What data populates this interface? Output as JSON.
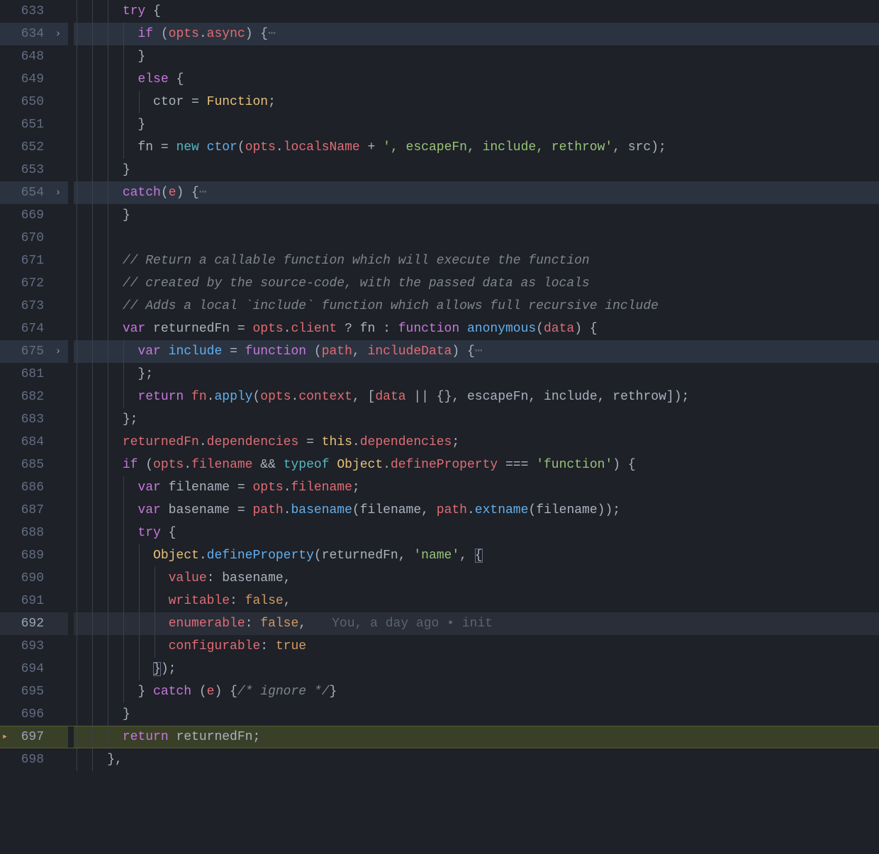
{
  "lines": [
    {
      "n": 633,
      "fold": "",
      "cls": "",
      "seg": [
        {
          "t": "      ",
          "c": "t",
          "guides": 3
        },
        {
          "t": "try",
          "c": "k"
        },
        {
          "t": " {",
          "c": "p"
        }
      ]
    },
    {
      "n": 634,
      "fold": ">",
      "cls": "folded",
      "seg": [
        {
          "t": "        ",
          "c": "t",
          "guides": 4
        },
        {
          "t": "if",
          "c": "k"
        },
        {
          "t": " (",
          "c": "p"
        },
        {
          "t": "opts",
          "c": "v"
        },
        {
          "t": ".",
          "c": "p"
        },
        {
          "t": "async",
          "c": "prop"
        },
        {
          "t": ") {",
          "c": "p"
        },
        {
          "t": "⋯",
          "c": "dim",
          "ell": true
        }
      ]
    },
    {
      "n": 648,
      "fold": "",
      "cls": "",
      "seg": [
        {
          "t": "        ",
          "c": "t",
          "guides": 4
        },
        {
          "t": "}",
          "c": "p"
        }
      ]
    },
    {
      "n": 649,
      "fold": "",
      "cls": "",
      "seg": [
        {
          "t": "        ",
          "c": "t",
          "guides": 4
        },
        {
          "t": "else",
          "c": "k"
        },
        {
          "t": " {",
          "c": "p"
        }
      ]
    },
    {
      "n": 650,
      "fold": "",
      "cls": "",
      "seg": [
        {
          "t": "          ",
          "c": "t",
          "guides": 5
        },
        {
          "t": "ctor",
          "c": "t"
        },
        {
          "t": " = ",
          "c": "p"
        },
        {
          "t": "Function",
          "c": "cl"
        },
        {
          "t": ";",
          "c": "p"
        }
      ]
    },
    {
      "n": 651,
      "fold": "",
      "cls": "",
      "seg": [
        {
          "t": "        ",
          "c": "t",
          "guides": 4
        },
        {
          "t": "}",
          "c": "p"
        }
      ]
    },
    {
      "n": 652,
      "fold": "",
      "cls": "",
      "seg": [
        {
          "t": "        ",
          "c": "t",
          "guides": 4
        },
        {
          "t": "fn",
          "c": "t"
        },
        {
          "t": " = ",
          "c": "p"
        },
        {
          "t": "new",
          "c": "o"
        },
        {
          "t": " ",
          "c": "p"
        },
        {
          "t": "ctor",
          "c": "f"
        },
        {
          "t": "(",
          "c": "p"
        },
        {
          "t": "opts",
          "c": "v"
        },
        {
          "t": ".",
          "c": "p"
        },
        {
          "t": "localsName",
          "c": "prop"
        },
        {
          "t": " + ",
          "c": "p"
        },
        {
          "t": "', escapeFn, include, rethrow'",
          "c": "s"
        },
        {
          "t": ", ",
          "c": "p"
        },
        {
          "t": "src",
          "c": "t"
        },
        {
          "t": ");",
          "c": "p"
        }
      ]
    },
    {
      "n": 653,
      "fold": "",
      "cls": "",
      "seg": [
        {
          "t": "      ",
          "c": "t",
          "guides": 3
        },
        {
          "t": "}",
          "c": "p"
        }
      ]
    },
    {
      "n": 654,
      "fold": ">",
      "cls": "folded",
      "seg": [
        {
          "t": "      ",
          "c": "t",
          "guides": 3
        },
        {
          "t": "catch",
          "c": "k"
        },
        {
          "t": "(",
          "c": "p"
        },
        {
          "t": "e",
          "c": "v"
        },
        {
          "t": ") {",
          "c": "p"
        },
        {
          "t": "⋯",
          "c": "dim",
          "ell": true
        }
      ]
    },
    {
      "n": 669,
      "fold": "",
      "cls": "",
      "seg": [
        {
          "t": "      ",
          "c": "t",
          "guides": 3
        },
        {
          "t": "}",
          "c": "p"
        }
      ]
    },
    {
      "n": 670,
      "fold": "",
      "cls": "",
      "seg": [
        {
          "t": "",
          "c": "t",
          "guides": 3
        }
      ]
    },
    {
      "n": 671,
      "fold": "",
      "cls": "",
      "seg": [
        {
          "t": "      ",
          "c": "t",
          "guides": 3
        },
        {
          "t": "// Return a callable function which will execute the function",
          "c": "c"
        }
      ]
    },
    {
      "n": 672,
      "fold": "",
      "cls": "",
      "seg": [
        {
          "t": "      ",
          "c": "t",
          "guides": 3
        },
        {
          "t": "// created by the source-code, with the passed data as locals",
          "c": "c"
        }
      ]
    },
    {
      "n": 673,
      "fold": "",
      "cls": "",
      "seg": [
        {
          "t": "      ",
          "c": "t",
          "guides": 3
        },
        {
          "t": "// Adds a local `include` function which allows full recursive include",
          "c": "c"
        }
      ]
    },
    {
      "n": 674,
      "fold": "",
      "cls": "",
      "seg": [
        {
          "t": "      ",
          "c": "t",
          "guides": 3
        },
        {
          "t": "var",
          "c": "kv"
        },
        {
          "t": " ",
          "c": "p"
        },
        {
          "t": "returnedFn",
          "c": "t"
        },
        {
          "t": " = ",
          "c": "p"
        },
        {
          "t": "opts",
          "c": "v"
        },
        {
          "t": ".",
          "c": "p"
        },
        {
          "t": "client",
          "c": "prop"
        },
        {
          "t": " ? ",
          "c": "p"
        },
        {
          "t": "fn",
          "c": "t"
        },
        {
          "t": " : ",
          "c": "p"
        },
        {
          "t": "function",
          "c": "kv"
        },
        {
          "t": " ",
          "c": "p"
        },
        {
          "t": "anonymous",
          "c": "f"
        },
        {
          "t": "(",
          "c": "p"
        },
        {
          "t": "data",
          "c": "v"
        },
        {
          "t": ") {",
          "c": "p"
        }
      ]
    },
    {
      "n": 675,
      "fold": ">",
      "cls": "folded",
      "seg": [
        {
          "t": "        ",
          "c": "t",
          "guides": 4
        },
        {
          "t": "var",
          "c": "kv"
        },
        {
          "t": " ",
          "c": "p"
        },
        {
          "t": "include",
          "c": "f"
        },
        {
          "t": " = ",
          "c": "p"
        },
        {
          "t": "function",
          "c": "kv"
        },
        {
          "t": " (",
          "c": "p"
        },
        {
          "t": "path",
          "c": "v"
        },
        {
          "t": ", ",
          "c": "p"
        },
        {
          "t": "includeData",
          "c": "v"
        },
        {
          "t": ") {",
          "c": "p"
        },
        {
          "t": "⋯",
          "c": "dim",
          "ell": true
        }
      ]
    },
    {
      "n": 681,
      "fold": "",
      "cls": "",
      "seg": [
        {
          "t": "        ",
          "c": "t",
          "guides": 4
        },
        {
          "t": "};",
          "c": "p"
        }
      ]
    },
    {
      "n": 682,
      "fold": "",
      "cls": "",
      "seg": [
        {
          "t": "        ",
          "c": "t",
          "guides": 4
        },
        {
          "t": "return",
          "c": "k"
        },
        {
          "t": " ",
          "c": "p"
        },
        {
          "t": "fn",
          "c": "v"
        },
        {
          "t": ".",
          "c": "p"
        },
        {
          "t": "apply",
          "c": "f"
        },
        {
          "t": "(",
          "c": "p"
        },
        {
          "t": "opts",
          "c": "v"
        },
        {
          "t": ".",
          "c": "p"
        },
        {
          "t": "context",
          "c": "prop"
        },
        {
          "t": ", [",
          "c": "p"
        },
        {
          "t": "data",
          "c": "v"
        },
        {
          "t": " || {}, ",
          "c": "p"
        },
        {
          "t": "escapeFn",
          "c": "t"
        },
        {
          "t": ", ",
          "c": "p"
        },
        {
          "t": "include",
          "c": "t"
        },
        {
          "t": ", ",
          "c": "p"
        },
        {
          "t": "rethrow",
          "c": "t"
        },
        {
          "t": "]);",
          "c": "p"
        }
      ]
    },
    {
      "n": 683,
      "fold": "",
      "cls": "",
      "seg": [
        {
          "t": "      ",
          "c": "t",
          "guides": 3
        },
        {
          "t": "};",
          "c": "p"
        }
      ]
    },
    {
      "n": 684,
      "fold": "",
      "cls": "",
      "seg": [
        {
          "t": "      ",
          "c": "t",
          "guides": 3
        },
        {
          "t": "returnedFn",
          "c": "v"
        },
        {
          "t": ".",
          "c": "p"
        },
        {
          "t": "dependencies",
          "c": "prop"
        },
        {
          "t": " = ",
          "c": "p"
        },
        {
          "t": "this",
          "c": "cl"
        },
        {
          "t": ".",
          "c": "p"
        },
        {
          "t": "dependencies",
          "c": "prop"
        },
        {
          "t": ";",
          "c": "p"
        }
      ]
    },
    {
      "n": 685,
      "fold": "",
      "cls": "",
      "seg": [
        {
          "t": "      ",
          "c": "t",
          "guides": 3
        },
        {
          "t": "if",
          "c": "k"
        },
        {
          "t": " (",
          "c": "p"
        },
        {
          "t": "opts",
          "c": "v"
        },
        {
          "t": ".",
          "c": "p"
        },
        {
          "t": "filename",
          "c": "prop"
        },
        {
          "t": " && ",
          "c": "p"
        },
        {
          "t": "typeof",
          "c": "o"
        },
        {
          "t": " ",
          "c": "p"
        },
        {
          "t": "Object",
          "c": "cl"
        },
        {
          "t": ".",
          "c": "p"
        },
        {
          "t": "defineProperty",
          "c": "prop"
        },
        {
          "t": " === ",
          "c": "p"
        },
        {
          "t": "'function'",
          "c": "s"
        },
        {
          "t": ") {",
          "c": "p"
        }
      ]
    },
    {
      "n": 686,
      "fold": "",
      "cls": "",
      "seg": [
        {
          "t": "        ",
          "c": "t",
          "guides": 4
        },
        {
          "t": "var",
          "c": "kv"
        },
        {
          "t": " ",
          "c": "p"
        },
        {
          "t": "filename",
          "c": "t"
        },
        {
          "t": " = ",
          "c": "p"
        },
        {
          "t": "opts",
          "c": "v"
        },
        {
          "t": ".",
          "c": "p"
        },
        {
          "t": "filename",
          "c": "prop"
        },
        {
          "t": ";",
          "c": "p"
        }
      ]
    },
    {
      "n": 687,
      "fold": "",
      "cls": "",
      "seg": [
        {
          "t": "        ",
          "c": "t",
          "guides": 4
        },
        {
          "t": "var",
          "c": "kv"
        },
        {
          "t": " ",
          "c": "p"
        },
        {
          "t": "basename",
          "c": "t"
        },
        {
          "t": " = ",
          "c": "p"
        },
        {
          "t": "path",
          "c": "v"
        },
        {
          "t": ".",
          "c": "p"
        },
        {
          "t": "basename",
          "c": "f"
        },
        {
          "t": "(",
          "c": "p"
        },
        {
          "t": "filename",
          "c": "t"
        },
        {
          "t": ", ",
          "c": "p"
        },
        {
          "t": "path",
          "c": "v"
        },
        {
          "t": ".",
          "c": "p"
        },
        {
          "t": "extname",
          "c": "f"
        },
        {
          "t": "(",
          "c": "p"
        },
        {
          "t": "filename",
          "c": "t"
        },
        {
          "t": "));",
          "c": "p"
        }
      ]
    },
    {
      "n": 688,
      "fold": "",
      "cls": "",
      "seg": [
        {
          "t": "        ",
          "c": "t",
          "guides": 4
        },
        {
          "t": "try",
          "c": "k"
        },
        {
          "t": " {",
          "c": "p"
        }
      ]
    },
    {
      "n": 689,
      "fold": "",
      "cls": "",
      "seg": [
        {
          "t": "          ",
          "c": "t",
          "guides": 5
        },
        {
          "t": "Object",
          "c": "cl"
        },
        {
          "t": ".",
          "c": "p"
        },
        {
          "t": "defineProperty",
          "c": "f"
        },
        {
          "t": "(",
          "c": "p"
        },
        {
          "t": "returnedFn",
          "c": "t"
        },
        {
          "t": ", ",
          "c": "p"
        },
        {
          "t": "'name'",
          "c": "s"
        },
        {
          "t": ", ",
          "c": "p"
        },
        {
          "t": "{",
          "c": "p",
          "bmatch": true
        }
      ]
    },
    {
      "n": 690,
      "fold": "",
      "cls": "",
      "seg": [
        {
          "t": "            ",
          "c": "t",
          "guides": 6
        },
        {
          "t": "value",
          "c": "v"
        },
        {
          "t": ":",
          "c": "p"
        },
        {
          "t": " basename",
          "c": "t"
        },
        {
          "t": ",",
          "c": "p"
        }
      ]
    },
    {
      "n": 691,
      "fold": "",
      "cls": "",
      "seg": [
        {
          "t": "            ",
          "c": "t",
          "guides": 6
        },
        {
          "t": "writable",
          "c": "v"
        },
        {
          "t": ":",
          "c": "p"
        },
        {
          "t": " ",
          "c": "t"
        },
        {
          "t": "false",
          "c": "b"
        },
        {
          "t": ",",
          "c": "p"
        }
      ]
    },
    {
      "n": 692,
      "fold": "",
      "cls": "current",
      "seg": [
        {
          "t": "            ",
          "c": "t",
          "guides": 6
        },
        {
          "t": "enumerable",
          "c": "v"
        },
        {
          "t": ":",
          "c": "p"
        },
        {
          "t": " ",
          "c": "t"
        },
        {
          "t": "false",
          "c": "b"
        },
        {
          "t": ",",
          "c": "p"
        }
      ],
      "blame": "You, a day ago • init"
    },
    {
      "n": 693,
      "fold": "",
      "cls": "",
      "seg": [
        {
          "t": "            ",
          "c": "t",
          "guides": 6
        },
        {
          "t": "configurable",
          "c": "v"
        },
        {
          "t": ":",
          "c": "p"
        },
        {
          "t": " ",
          "c": "t"
        },
        {
          "t": "true",
          "c": "b"
        }
      ]
    },
    {
      "n": 694,
      "fold": "",
      "cls": "",
      "seg": [
        {
          "t": "          ",
          "c": "t",
          "guides": 5
        },
        {
          "t": "}",
          "c": "p",
          "bmatch": true
        },
        {
          "t": ");",
          "c": "p"
        }
      ]
    },
    {
      "n": 695,
      "fold": "",
      "cls": "",
      "seg": [
        {
          "t": "        ",
          "c": "t",
          "guides": 4
        },
        {
          "t": "} ",
          "c": "p"
        },
        {
          "t": "catch",
          "c": "k"
        },
        {
          "t": " (",
          "c": "p"
        },
        {
          "t": "e",
          "c": "v"
        },
        {
          "t": ") {",
          "c": "p"
        },
        {
          "t": "/* ignore */",
          "c": "c"
        },
        {
          "t": "}",
          "c": "p"
        }
      ]
    },
    {
      "n": 696,
      "fold": "",
      "cls": "",
      "seg": [
        {
          "t": "      ",
          "c": "t",
          "guides": 3
        },
        {
          "t": "}",
          "c": "p"
        }
      ]
    },
    {
      "n": 697,
      "fold": "",
      "cls": "highlight",
      "marker": "▸",
      "seg": [
        {
          "t": "      ",
          "c": "t",
          "guides": 3
        },
        {
          "t": "return",
          "c": "k"
        },
        {
          "t": " ",
          "c": "p"
        },
        {
          "t": "returnedFn",
          "c": "t"
        },
        {
          "t": ";",
          "c": "p"
        }
      ]
    },
    {
      "n": 698,
      "fold": "",
      "cls": "",
      "seg": [
        {
          "t": "    ",
          "c": "t",
          "guides": 2
        },
        {
          "t": "},",
          "c": "p"
        }
      ]
    }
  ]
}
